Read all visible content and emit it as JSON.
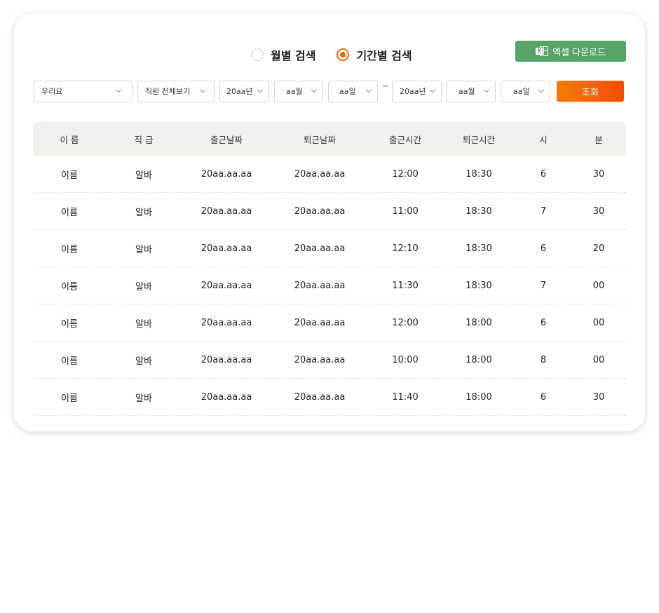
{
  "search_mode": {
    "options": [
      {
        "label": "월별 검색",
        "checked": false
      },
      {
        "label": "기간별 검색",
        "checked": true
      }
    ],
    "accent_color": "#f26a12"
  },
  "excel_button": {
    "label": "엑셀 다운로드",
    "icon": "excel-icon",
    "color": "#55a567"
  },
  "filters": {
    "store": "우리요",
    "employee": "직원 전체보기",
    "start_year": "20aa년",
    "start_month": "aa월",
    "start_day": "aa일",
    "range_separator": "~",
    "end_year": "20aa년",
    "end_month": "aa월",
    "end_day": "aa일",
    "search_label": "조회"
  },
  "table": {
    "headers": [
      "이 름",
      "직 급",
      "출근날짜",
      "퇴근날짜",
      "출근시간",
      "퇴근시간",
      "시",
      "분"
    ],
    "rows": [
      [
        "이름",
        "알바",
        "20aa.aa.aa",
        "20aa.aa.aa",
        "12:00",
        "18:30",
        "6",
        "30"
      ],
      [
        "이름",
        "알바",
        "20aa.aa.aa",
        "20aa.aa.aa",
        "11:00",
        "18:30",
        "7",
        "30"
      ],
      [
        "이름",
        "알바",
        "20aa.aa.aa",
        "20aa.aa.aa",
        "12:10",
        "18:30",
        "6",
        "20"
      ],
      [
        "이름",
        "알바",
        "20aa.aa.aa",
        "20aa.aa.aa",
        "11:30",
        "18:30",
        "7",
        "00"
      ],
      [
        "이름",
        "알바",
        "20aa.aa.aa",
        "20aa.aa.aa",
        "12:00",
        "18:00",
        "6",
        "00"
      ],
      [
        "이름",
        "알바",
        "20aa.aa.aa",
        "20aa.aa.aa",
        "10:00",
        "18:00",
        "8",
        "00"
      ],
      [
        "이름",
        "알바",
        "20aa.aa.aa",
        "20aa.aa.aa",
        "11:40",
        "18:00",
        "6",
        "30"
      ]
    ]
  }
}
